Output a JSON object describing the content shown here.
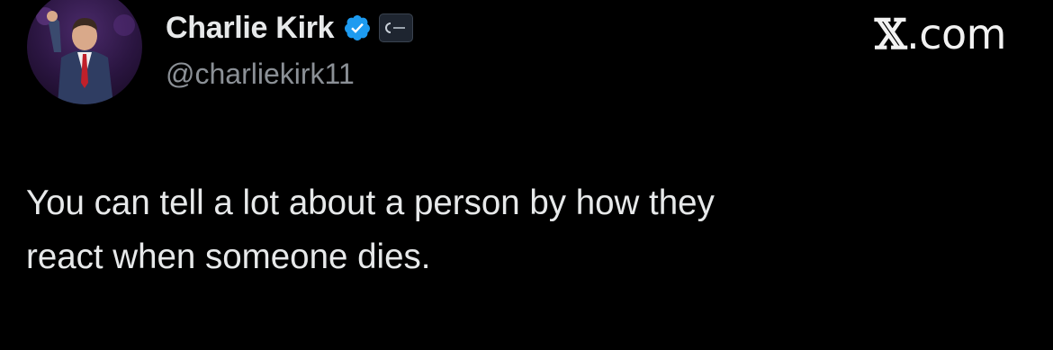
{
  "author": {
    "display_name": "Charlie Kirk",
    "handle": "@charliekirk11",
    "verified": true,
    "verified_icon": "verified-badge-icon",
    "affiliate_icon": "affiliate-badge-icon",
    "avatar": "profile-avatar"
  },
  "site": {
    "label_x": "𝕏",
    "label_domain": ".com"
  },
  "tweet": {
    "text": "You can tell a lot about a person by how they\nreact when someone dies."
  },
  "colors": {
    "background": "#000000",
    "text_primary": "#e7e9ea",
    "text_secondary": "#8b9096",
    "verified_blue": "#1d9bf0"
  }
}
